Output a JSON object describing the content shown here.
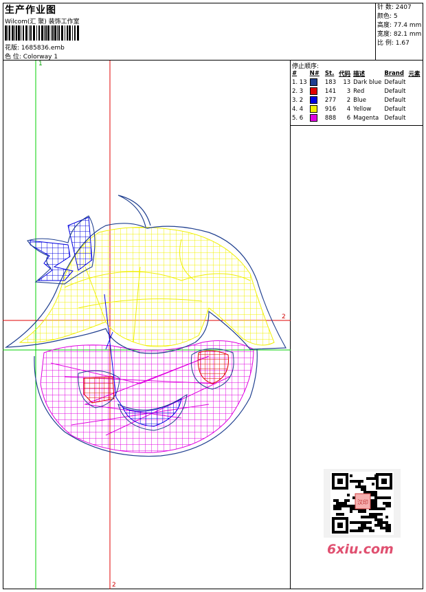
{
  "header": {
    "title": "生产作业图",
    "subtitle": "Wilcom(汇 聚) 装饰工作室",
    "design_label": "花版:",
    "design_value": "1685836.emb",
    "colorway_label": "色 位:",
    "colorway_value": "Colorway 1"
  },
  "stats": [
    {
      "label": "针 数:",
      "value": "2407"
    },
    {
      "label": "颜色:",
      "value": "5"
    },
    {
      "label": "高度:",
      "value": "77.4 mm"
    },
    {
      "label": "宽度:",
      "value": "82.1 mm"
    },
    {
      "label": "比 例:",
      "value": "1.67"
    }
  ],
  "stop_sequence": {
    "title": "停止顺序:",
    "columns": [
      "#",
      "N#",
      "St.",
      "代码",
      "描述",
      "Brand",
      "元素"
    ],
    "rows": [
      {
        "num": "1. 13",
        "color": "#1f3f8f",
        "st": "183",
        "code": "13",
        "desc": "Dark blue",
        "brand": "Default"
      },
      {
        "num": "2. 3",
        "color": "#e00000",
        "st": "141",
        "code": "3",
        "desc": "Red",
        "brand": "Default"
      },
      {
        "num": "3. 2",
        "color": "#0000e0",
        "st": "277",
        "code": "2",
        "desc": "Blue",
        "brand": "Default"
      },
      {
        "num": "4. 4",
        "color": "#f0f000",
        "st": "916",
        "code": "4",
        "desc": "Yellow",
        "brand": "Default"
      },
      {
        "num": "5. 6",
        "color": "#e000e0",
        "st": "888",
        "code": "6",
        "desc": "Magenta",
        "brand": "Default"
      }
    ]
  },
  "guides": {
    "green_v": "1",
    "red_h": "2",
    "red_v": "2"
  },
  "watermark": "6xiu.com",
  "qr_stamp": "汉印"
}
